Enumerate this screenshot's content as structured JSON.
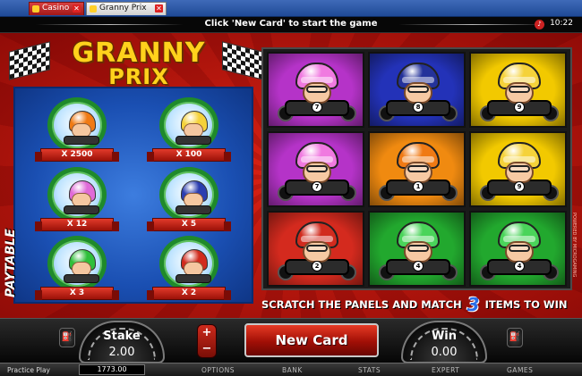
{
  "browser": {
    "tabs": [
      {
        "label": "Casino",
        "active": false
      },
      {
        "label": "Granny Prix",
        "active": true
      }
    ]
  },
  "infobar": {
    "message": "Click 'New Card' to start the game",
    "clock": "10:22"
  },
  "logo": {
    "line1": "GRANNY",
    "line2": "PRIX"
  },
  "paytable": {
    "label": "PAYTABLE",
    "items": [
      {
        "multiplier": "X 2500",
        "helmet": "#f07a14"
      },
      {
        "multiplier": "X 100",
        "helmet": "#f5d23a"
      },
      {
        "multiplier": "X 12",
        "helmet": "#e06ad8"
      },
      {
        "multiplier": "X 5",
        "helmet": "#2b3db0"
      },
      {
        "multiplier": "X 3",
        "helmet": "#2fbf3a"
      },
      {
        "multiplier": "X 2",
        "helmet": "#d12b1e"
      }
    ]
  },
  "grid": {
    "cells": [
      {
        "bg": "#b533c8",
        "helmet": "#f07ae0",
        "number": "7"
      },
      {
        "bg": "#2332b8",
        "helmet": "#24329a",
        "number": "8"
      },
      {
        "bg": "#f2c900",
        "helmet": "#f5d23a",
        "number": "9"
      },
      {
        "bg": "#b533c8",
        "helmet": "#f07ae0",
        "number": "7"
      },
      {
        "bg": "#f08a10",
        "helmet": "#f07a14",
        "number": "1"
      },
      {
        "bg": "#f2c900",
        "helmet": "#f5d23a",
        "number": "9"
      },
      {
        "bg": "#d42a1e",
        "helmet": "#d12b1e",
        "number": "2"
      },
      {
        "bg": "#22a82e",
        "helmet": "#4ad45a",
        "number": "4"
      },
      {
        "bg": "#22a82e",
        "helmet": "#4ad45a",
        "number": "4"
      }
    ]
  },
  "scratch_message": {
    "before": "SCRATCH THE PANELS AND MATCH",
    "number": "3",
    "after": "ITEMS TO WIN"
  },
  "powered_by": "POWERED BY MICROGAMING",
  "console": {
    "stake_label": "Stake",
    "stake_value": "2.00",
    "plus": "+",
    "minus": "−",
    "new_card": "New Card",
    "win_label": "Win",
    "win_value": "0.00"
  },
  "statusbar": {
    "practice": "Practice Play",
    "balance": "1773.00",
    "menu": [
      "OPTIONS",
      "BANK",
      "STATS",
      "EXPERT",
      "GAMES"
    ]
  }
}
